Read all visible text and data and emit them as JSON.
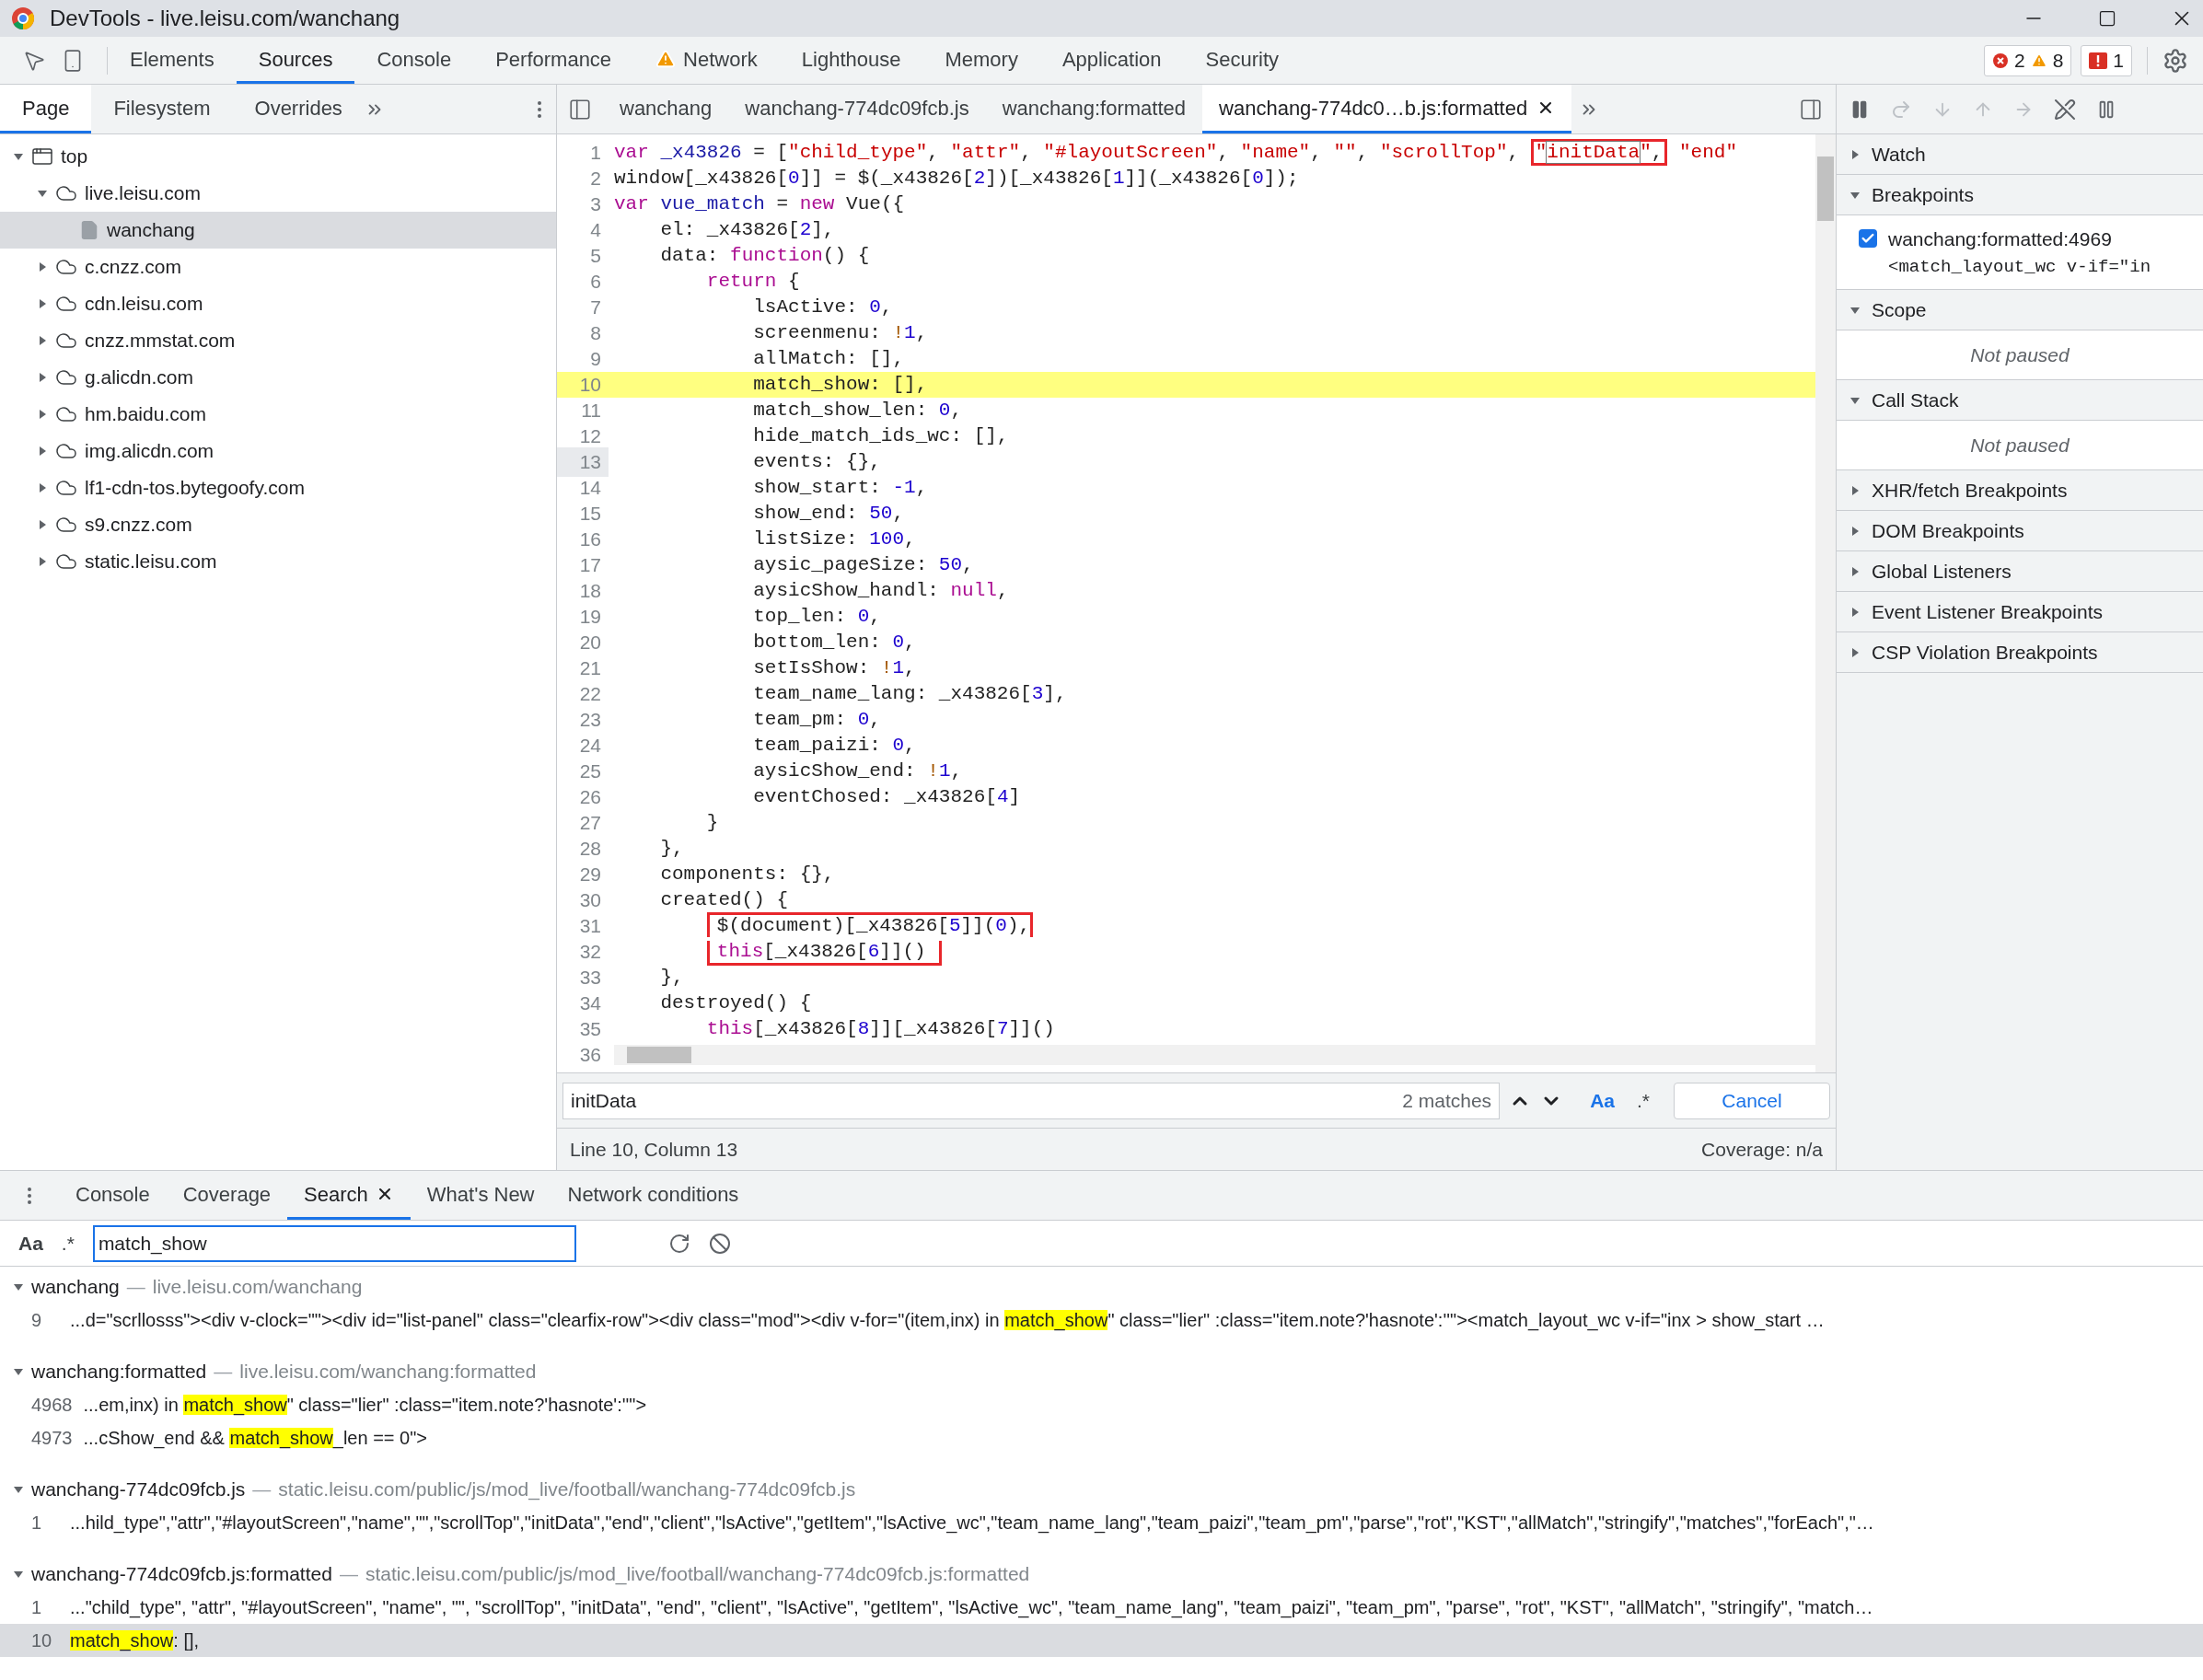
{
  "window": {
    "title": "DevTools - live.leisu.com/wanchang"
  },
  "main_tabs": [
    {
      "label": "Elements",
      "selected": false,
      "warning": false
    },
    {
      "label": "Sources",
      "selected": true,
      "warning": false
    },
    {
      "label": "Console",
      "selected": false,
      "warning": false
    },
    {
      "label": "Performance",
      "selected": false,
      "warning": false
    },
    {
      "label": "Network",
      "selected": false,
      "warning": true
    },
    {
      "label": "Lighthouse",
      "selected": false,
      "warning": false
    },
    {
      "label": "Memory",
      "selected": false,
      "warning": false
    },
    {
      "label": "Application",
      "selected": false,
      "warning": false
    },
    {
      "label": "Security",
      "selected": false,
      "warning": false
    }
  ],
  "issue_counts": {
    "errors": "2",
    "warnings": "8",
    "issues": "1"
  },
  "navigator": {
    "tabs": [
      {
        "label": "Page",
        "selected": true
      },
      {
        "label": "Filesystem",
        "selected": false
      },
      {
        "label": "Overrides",
        "selected": false
      }
    ],
    "tree": [
      {
        "label": "top",
        "kind": "frame",
        "expanded": true,
        "selected": false,
        "children": [
          {
            "label": "live.leisu.com",
            "kind": "domain",
            "expanded": true,
            "selected": false,
            "children": [
              {
                "label": "wanchang",
                "kind": "file",
                "selected": true
              }
            ]
          },
          {
            "label": "c.cnzz.com",
            "kind": "domain",
            "expanded": false,
            "selected": false
          },
          {
            "label": "cdn.leisu.com",
            "kind": "domain",
            "expanded": false,
            "selected": false
          },
          {
            "label": "cnzz.mmstat.com",
            "kind": "domain",
            "expanded": false,
            "selected": false
          },
          {
            "label": "g.alicdn.com",
            "kind": "domain",
            "expanded": false,
            "selected": false
          },
          {
            "label": "hm.baidu.com",
            "kind": "domain",
            "expanded": false,
            "selected": false
          },
          {
            "label": "img.alicdn.com",
            "kind": "domain",
            "expanded": false,
            "selected": false
          },
          {
            "label": "lf1-cdn-tos.bytegoofy.com",
            "kind": "domain",
            "expanded": false,
            "selected": false
          },
          {
            "label": "s9.cnzz.com",
            "kind": "domain",
            "expanded": false,
            "selected": false
          },
          {
            "label": "static.leisu.com",
            "kind": "domain",
            "expanded": false,
            "selected": false
          }
        ]
      }
    ]
  },
  "editor": {
    "tabs": [
      {
        "label": "wanchang",
        "selected": false
      },
      {
        "label": "wanchang-774dc09fcb.js",
        "selected": false
      },
      {
        "label": "wanchang:formatted",
        "selected": false
      },
      {
        "label": "wanchang-774dc0…b.js:formatted",
        "selected": true
      }
    ],
    "lines": [
      {
        "number": "1",
        "highlighted": false,
        "marked": false,
        "annotated": false,
        "tokens": [
          {
            "kind": "keyword",
            "text": "var "
          },
          {
            "kind": "def",
            "text": "_x43826"
          },
          {
            "kind": "plain",
            "text": " = ["
          },
          {
            "kind": "string",
            "text": "\"child_type\""
          },
          {
            "kind": "plain",
            "text": ", "
          },
          {
            "kind": "string",
            "text": "\"attr\""
          },
          {
            "kind": "plain",
            "text": ", "
          },
          {
            "kind": "string",
            "text": "\"#layoutScreen\""
          },
          {
            "kind": "plain",
            "text": ", "
          },
          {
            "kind": "string",
            "text": "\"name\""
          },
          {
            "kind": "plain",
            "text": ", "
          },
          {
            "kind": "string",
            "text": "\"\""
          },
          {
            "kind": "plain",
            "text": ", "
          },
          {
            "kind": "string",
            "text": "\"scrollTop\""
          },
          {
            "kind": "plain",
            "text": ", "
          },
          {
            "kind": "annotation",
            "tokens": [
              {
                "kind": "string",
                "text": "\""
              },
              {
                "kind": "search_match",
                "text": "initData"
              },
              {
                "kind": "string",
                "text": "\""
              },
              {
                "kind": "plain",
                "text": ","
              }
            ]
          },
          {
            "kind": "string",
            "text": " \"end\""
          }
        ]
      },
      {
        "number": "2",
        "highlighted": false,
        "marked": false,
        "annotated": false,
        "tokens": [
          {
            "kind": "plain",
            "text": "window[_x43826["
          },
          {
            "kind": "number",
            "text": "0"
          },
          {
            "kind": "plain",
            "text": "]] = $(_x43826["
          },
          {
            "kind": "number",
            "text": "2"
          },
          {
            "kind": "plain",
            "text": "])[_x43826["
          },
          {
            "kind": "number",
            "text": "1"
          },
          {
            "kind": "plain",
            "text": "]](_x43826["
          },
          {
            "kind": "number",
            "text": "0"
          },
          {
            "kind": "plain",
            "text": "]);"
          }
        ]
      },
      {
        "number": "3",
        "highlighted": false,
        "marked": false,
        "annotated": false,
        "tokens": [
          {
            "kind": "keyword",
            "text": "var "
          },
          {
            "kind": "def",
            "text": "vue_match"
          },
          {
            "kind": "plain",
            "text": " = "
          },
          {
            "kind": "keyword",
            "text": "new"
          },
          {
            "kind": "plain",
            "text": " Vue({"
          }
        ]
      },
      {
        "number": "4",
        "highlighted": false,
        "marked": false,
        "annotated": false,
        "tokens": [
          {
            "kind": "plain",
            "text": "    el: _x43826["
          },
          {
            "kind": "number",
            "text": "2"
          },
          {
            "kind": "plain",
            "text": "],"
          }
        ]
      },
      {
        "number": "5",
        "highlighted": false,
        "marked": false,
        "annotated": false,
        "tokens": [
          {
            "kind": "plain",
            "text": "    data: "
          },
          {
            "kind": "keyword",
            "text": "function"
          },
          {
            "kind": "plain",
            "text": "() {"
          }
        ]
      },
      {
        "number": "6",
        "highlighted": false,
        "marked": false,
        "annotated": false,
        "tokens": [
          {
            "kind": "keyword",
            "text": "        return"
          },
          {
            "kind": "plain",
            "text": " {"
          }
        ]
      },
      {
        "number": "7",
        "highlighted": false,
        "marked": false,
        "annotated": false,
        "tokens": [
          {
            "kind": "plain",
            "text": "            lsActive: "
          },
          {
            "kind": "number",
            "text": "0"
          },
          {
            "kind": "plain",
            "text": ","
          }
        ]
      },
      {
        "number": "8",
        "highlighted": false,
        "marked": false,
        "annotated": false,
        "tokens": [
          {
            "kind": "plain",
            "text": "            screenmenu: "
          },
          {
            "kind": "operator",
            "text": "!"
          },
          {
            "kind": "number",
            "text": "1"
          },
          {
            "kind": "plain",
            "text": ","
          }
        ]
      },
      {
        "number": "9",
        "highlighted": false,
        "marked": false,
        "annotated": false,
        "tokens": [
          {
            "kind": "plain",
            "text": "            allMatch: [],"
          }
        ]
      },
      {
        "number": "10",
        "highlighted": true,
        "marked": false,
        "annotated": false,
        "tokens": [
          {
            "kind": "plain",
            "text": "            match_show: [],"
          }
        ]
      },
      {
        "number": "11",
        "highlighted": false,
        "marked": false,
        "annotated": false,
        "tokens": [
          {
            "kind": "plain",
            "text": "            match_show_len: "
          },
          {
            "kind": "number",
            "text": "0"
          },
          {
            "kind": "plain",
            "text": ","
          }
        ]
      },
      {
        "number": "12",
        "highlighted": false,
        "marked": false,
        "annotated": false,
        "tokens": [
          {
            "kind": "plain",
            "text": "            hide_match_ids_wc: [],"
          }
        ]
      },
      {
        "number": "13",
        "highlighted": false,
        "marked": true,
        "annotated": false,
        "tokens": [
          {
            "kind": "plain",
            "text": "            events: {},"
          }
        ]
      },
      {
        "number": "14",
        "highlighted": false,
        "marked": false,
        "annotated": false,
        "tokens": [
          {
            "kind": "plain",
            "text": "            show_start: "
          },
          {
            "kind": "number",
            "text": "-1"
          },
          {
            "kind": "plain",
            "text": ","
          }
        ]
      },
      {
        "number": "15",
        "highlighted": false,
        "marked": false,
        "annotated": false,
        "tokens": [
          {
            "kind": "plain",
            "text": "            show_end: "
          },
          {
            "kind": "number",
            "text": "50"
          },
          {
            "kind": "plain",
            "text": ","
          }
        ]
      },
      {
        "number": "16",
        "highlighted": false,
        "marked": false,
        "annotated": false,
        "tokens": [
          {
            "kind": "plain",
            "text": "            listSize: "
          },
          {
            "kind": "number",
            "text": "100"
          },
          {
            "kind": "plain",
            "text": ","
          }
        ]
      },
      {
        "number": "17",
        "highlighted": false,
        "marked": false,
        "annotated": false,
        "tokens": [
          {
            "kind": "plain",
            "text": "            aysic_pageSize: "
          },
          {
            "kind": "number",
            "text": "50"
          },
          {
            "kind": "plain",
            "text": ","
          }
        ]
      },
      {
        "number": "18",
        "highlighted": false,
        "marked": false,
        "annotated": false,
        "tokens": [
          {
            "kind": "plain",
            "text": "            aysicShow_handl: "
          },
          {
            "kind": "keyword",
            "text": "null"
          },
          {
            "kind": "plain",
            "text": ","
          }
        ]
      },
      {
        "number": "19",
        "highlighted": false,
        "marked": false,
        "annotated": false,
        "tokens": [
          {
            "kind": "plain",
            "text": "            top_len: "
          },
          {
            "kind": "number",
            "text": "0"
          },
          {
            "kind": "plain",
            "text": ","
          }
        ]
      },
      {
        "number": "20",
        "highlighted": false,
        "marked": false,
        "annotated": false,
        "tokens": [
          {
            "kind": "plain",
            "text": "            bottom_len: "
          },
          {
            "kind": "number",
            "text": "0"
          },
          {
            "kind": "plain",
            "text": ","
          }
        ]
      },
      {
        "number": "21",
        "highlighted": false,
        "marked": false,
        "annotated": false,
        "tokens": [
          {
            "kind": "plain",
            "text": "            setIsShow: "
          },
          {
            "kind": "operator",
            "text": "!"
          },
          {
            "kind": "number",
            "text": "1"
          },
          {
            "kind": "plain",
            "text": ","
          }
        ]
      },
      {
        "number": "22",
        "highlighted": false,
        "marked": false,
        "annotated": false,
        "tokens": [
          {
            "kind": "plain",
            "text": "            team_name_lang: _x43826["
          },
          {
            "kind": "number",
            "text": "3"
          },
          {
            "kind": "plain",
            "text": "],"
          }
        ]
      },
      {
        "number": "23",
        "highlighted": false,
        "marked": false,
        "annotated": false,
        "tokens": [
          {
            "kind": "plain",
            "text": "            team_pm: "
          },
          {
            "kind": "number",
            "text": "0"
          },
          {
            "kind": "plain",
            "text": ","
          }
        ]
      },
      {
        "number": "24",
        "highlighted": false,
        "marked": false,
        "annotated": false,
        "tokens": [
          {
            "kind": "plain",
            "text": "            team_paizi: "
          },
          {
            "kind": "number",
            "text": "0"
          },
          {
            "kind": "plain",
            "text": ","
          }
        ]
      },
      {
        "number": "25",
        "highlighted": false,
        "marked": false,
        "annotated": false,
        "tokens": [
          {
            "kind": "plain",
            "text": "            aysicShow_end: "
          },
          {
            "kind": "operator",
            "text": "!"
          },
          {
            "kind": "number",
            "text": "1"
          },
          {
            "kind": "plain",
            "text": ","
          }
        ]
      },
      {
        "number": "26",
        "highlighted": false,
        "marked": false,
        "annotated": false,
        "tokens": [
          {
            "kind": "plain",
            "text": "            eventChosed: _x43826["
          },
          {
            "kind": "number",
            "text": "4"
          },
          {
            "kind": "plain",
            "text": "]"
          }
        ]
      },
      {
        "number": "27",
        "highlighted": false,
        "marked": false,
        "annotated": false,
        "tokens": [
          {
            "kind": "plain",
            "text": "        }"
          }
        ]
      },
      {
        "number": "28",
        "highlighted": false,
        "marked": false,
        "annotated": false,
        "tokens": [
          {
            "kind": "plain",
            "text": "    },"
          }
        ]
      },
      {
        "number": "29",
        "highlighted": false,
        "marked": false,
        "annotated": false,
        "tokens": [
          {
            "kind": "plain",
            "text": "    components: {},"
          }
        ]
      },
      {
        "number": "30",
        "highlighted": false,
        "marked": false,
        "annotated": false,
        "tokens": [
          {
            "kind": "plain",
            "text": "    created() {"
          }
        ]
      },
      {
        "number": "31",
        "highlighted": false,
        "marked": false,
        "annotated": true,
        "tokens": [
          {
            "kind": "plain",
            "text": "        $(document)[_x43826["
          },
          {
            "kind": "number",
            "text": "5"
          },
          {
            "kind": "plain",
            "text": "]]("
          },
          {
            "kind": "number",
            "text": "0"
          },
          {
            "kind": "plain",
            "text": "),"
          }
        ]
      },
      {
        "number": "32",
        "highlighted": false,
        "marked": false,
        "annotated": true,
        "tokens": [
          {
            "kind": "keyword",
            "text": "        this"
          },
          {
            "kind": "plain",
            "text": "[_x43826["
          },
          {
            "kind": "number",
            "text": "6"
          },
          {
            "kind": "plain",
            "text": "]]()"
          }
        ]
      },
      {
        "number": "33",
        "highlighted": false,
        "marked": false,
        "annotated": false,
        "tokens": [
          {
            "kind": "plain",
            "text": "    },"
          }
        ]
      },
      {
        "number": "34",
        "highlighted": false,
        "marked": false,
        "annotated": false,
        "tokens": [
          {
            "kind": "plain",
            "text": "    destroyed() {"
          }
        ]
      },
      {
        "number": "35",
        "highlighted": false,
        "marked": false,
        "annotated": false,
        "tokens": [
          {
            "kind": "keyword",
            "text": "        this"
          },
          {
            "kind": "plain",
            "text": "[_x43826["
          },
          {
            "kind": "number",
            "text": "8"
          },
          {
            "kind": "plain",
            "text": "]][_x43826["
          },
          {
            "kind": "number",
            "text": "7"
          },
          {
            "kind": "plain",
            "text": "]]()"
          }
        ]
      }
    ],
    "last_line_number": "36"
  },
  "find": {
    "query": "initData",
    "matches": "2 matches",
    "case_label": "Aa",
    "regex_label": ".*",
    "cancel": "Cancel"
  },
  "status": {
    "position": "Line 10, Column 13",
    "coverage": "Coverage: n/a"
  },
  "debugger": {
    "sections": [
      {
        "title": "Watch",
        "expanded": false
      },
      {
        "title": "Breakpoints",
        "expanded": true,
        "breakpoints": [
          {
            "location": "wanchang:formatted:4969",
            "code": "<match_layout_wc v-if=\"in",
            "checked": true
          }
        ]
      },
      {
        "title": "Scope",
        "expanded": true,
        "message": "Not paused"
      },
      {
        "title": "Call Stack",
        "expanded": true,
        "message": "Not paused"
      },
      {
        "title": "XHR/fetch Breakpoints",
        "expanded": false
      },
      {
        "title": "DOM Breakpoints",
        "expanded": false
      },
      {
        "title": "Global Listeners",
        "expanded": false
      },
      {
        "title": "Event Listener Breakpoints",
        "expanded": false
      },
      {
        "title": "CSP Violation Breakpoints",
        "expanded": false
      }
    ]
  },
  "drawer": {
    "tabs": [
      {
        "label": "Console",
        "selected": false,
        "closable": false
      },
      {
        "label": "Coverage",
        "selected": false,
        "closable": false
      },
      {
        "label": "Search",
        "selected": true,
        "closable": true
      },
      {
        "label": "What's New",
        "selected": false,
        "closable": false
      },
      {
        "label": "Network conditions",
        "selected": false,
        "closable": false
      }
    ],
    "search": {
      "case_label": "Aa",
      "regex_label": ".*",
      "query": "match_show"
    },
    "results": [
      {
        "file": "wanchang",
        "separator": "—",
        "url": "live.leisu.com/wanchang",
        "expanded": true,
        "matches": [
          {
            "line": "9",
            "selected": false,
            "segments": [
              {
                "text": "...d=\"scrllosss\"><div v-clock=\"\"><div id=\"list-panel\" class=\"clearfix-row\"><div class=\"mod\"><div v-for=\"(item,inx) in ",
                "match": false
              },
              {
                "text": "match_show",
                "match": true
              },
              {
                "text": "\" class=\"lier\" :class=\"item.note?'hasnote':''\"><match_layout_wc v-if=\"inx > show_start …",
                "match": false
              }
            ]
          }
        ]
      },
      {
        "file": "wanchang:formatted",
        "separator": "—",
        "url": "live.leisu.com/wanchang:formatted",
        "expanded": true,
        "matches": [
          {
            "line": "4968",
            "selected": false,
            "segments": [
              {
                "text": "...em,inx) in ",
                "match": false
              },
              {
                "text": "match_show",
                "match": true
              },
              {
                "text": "\" class=\"lier\" :class=\"item.note?'hasnote':''\">",
                "match": false
              }
            ]
          },
          {
            "line": "4973",
            "selected": false,
            "segments": [
              {
                "text": "...cShow_end && ",
                "match": false
              },
              {
                "text": "match_show",
                "match": true
              },
              {
                "text": "_len == 0\">",
                "match": false
              }
            ]
          }
        ]
      },
      {
        "file": "wanchang-774dc09fcb.js",
        "separator": "—",
        "url": "static.leisu.com/public/js/mod_live/football/wanchang-774dc09fcb.js",
        "expanded": true,
        "matches": [
          {
            "line": "1",
            "selected": false,
            "segments": [
              {
                "text": "...hild_type\",\"attr\",\"#layoutScreen\",\"name\",\"\",\"scrollTop\",\"initData\",\"end\",\"client\",\"lsActive\",\"getItem\",\"lsActive_wc\",\"team_name_lang\",\"team_paizi\",\"team_pm\",\"parse\",\"rot\",\"KST\",\"allMatch\",\"stringify\",\"matches\",\"forEach\",\"…",
                "match": false
              }
            ]
          }
        ]
      },
      {
        "file": "wanchang-774dc09fcb.js:formatted",
        "separator": "—",
        "url": "static.leisu.com/public/js/mod_live/football/wanchang-774dc09fcb.js:formatted",
        "expanded": true,
        "matches": [
          {
            "line": "1",
            "selected": false,
            "segments": [
              {
                "text": "...\"child_type\", \"attr\", \"#layoutScreen\", \"name\", \"\", \"scrollTop\", \"initData\", \"end\", \"client\", \"lsActive\", \"getItem\", \"lsActive_wc\", \"team_name_lang\", \"team_paizi\", \"team_pm\", \"parse\", \"rot\", \"KST\", \"allMatch\", \"stringify\", \"match…",
                "match": false
              }
            ]
          },
          {
            "line": "10",
            "selected": true,
            "segments": [
              {
                "text": "match_show",
                "match": true
              },
              {
                "text": ": [],",
                "match": false
              }
            ]
          }
        ]
      }
    ]
  }
}
